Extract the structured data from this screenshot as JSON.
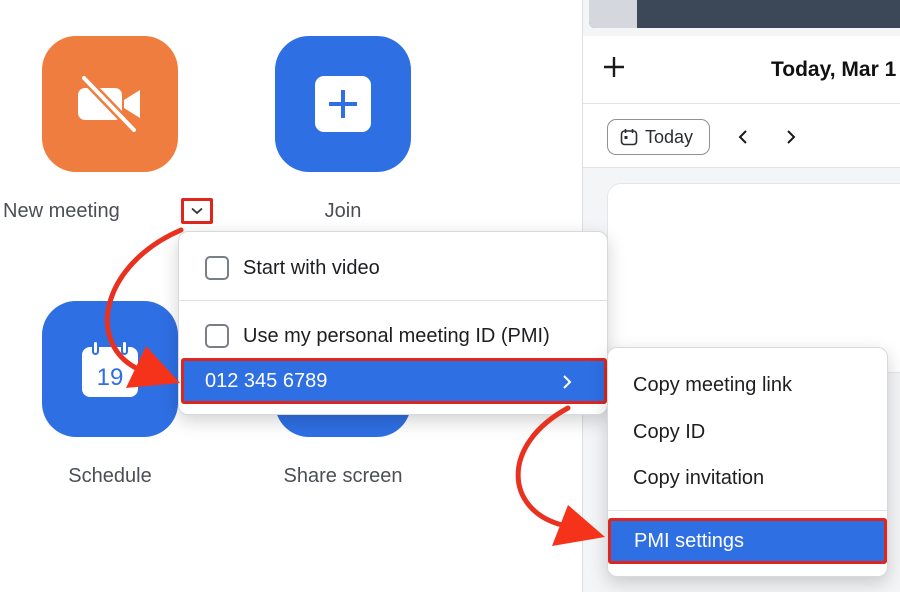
{
  "home": {
    "actions": [
      {
        "label": "New meeting",
        "icon": "video-off-icon",
        "color": "#ef7d3f"
      },
      {
        "label": "Join",
        "icon": "plus-icon",
        "color": "#2f6fe4"
      },
      {
        "label": "Schedule",
        "icon": "calendar-icon",
        "color": "#2f6fe4",
        "calendar_day": "19"
      },
      {
        "label": "Share screen",
        "icon": "share-screen-icon",
        "color": "#2f6fe4"
      }
    ]
  },
  "calendar": {
    "title": "Today, Mar 1",
    "today_button": "Today"
  },
  "new_meeting_menu": {
    "items": [
      {
        "label": "Start with video",
        "checked": false
      },
      {
        "label": "Use my personal meeting ID (PMI)",
        "checked": false
      }
    ],
    "pmi_number": "012 345 6789"
  },
  "pmi_submenu": {
    "items": [
      "Copy meeting link",
      "Copy ID",
      "Copy invitation"
    ],
    "settings_label": "PMI settings"
  },
  "colors": {
    "accent": "#2f6fe4",
    "highlight": "#e0261c",
    "orange": "#ef7d3f"
  }
}
